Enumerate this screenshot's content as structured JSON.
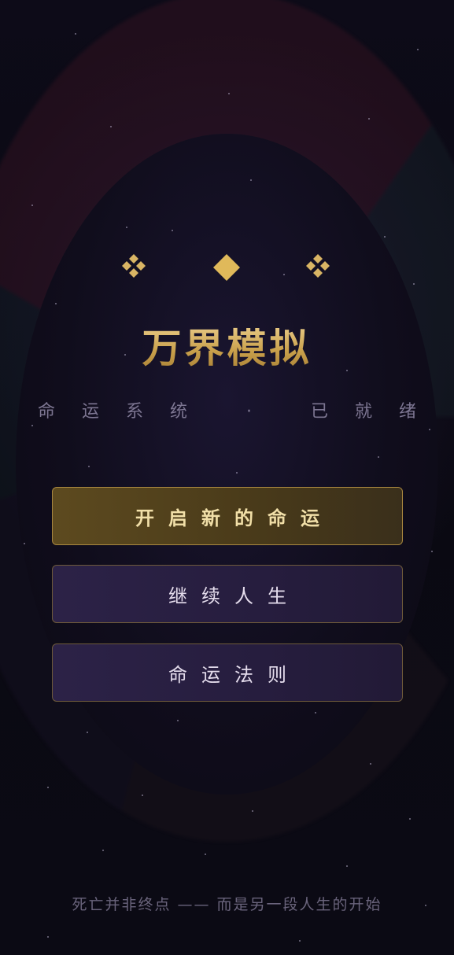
{
  "app": {
    "title": "万界模拟",
    "subtitle": "命运系统 · 已就绪"
  },
  "menu": {
    "start_label": "开启新的命运",
    "continue_label": "继续人生",
    "rules_label": "命运法则"
  },
  "footer": {
    "tagline": "死亡并非终点 —— 而是另一段人生的开始"
  },
  "icons": {
    "left": "four-diamond-cluster-icon",
    "center": "diamond-icon",
    "right": "four-diamond-cluster-icon"
  },
  "colors": {
    "gold": "#d9b564",
    "background": "#0b0913",
    "primary_button": "#5d4a1f",
    "secondary_button": "#2c2247"
  }
}
